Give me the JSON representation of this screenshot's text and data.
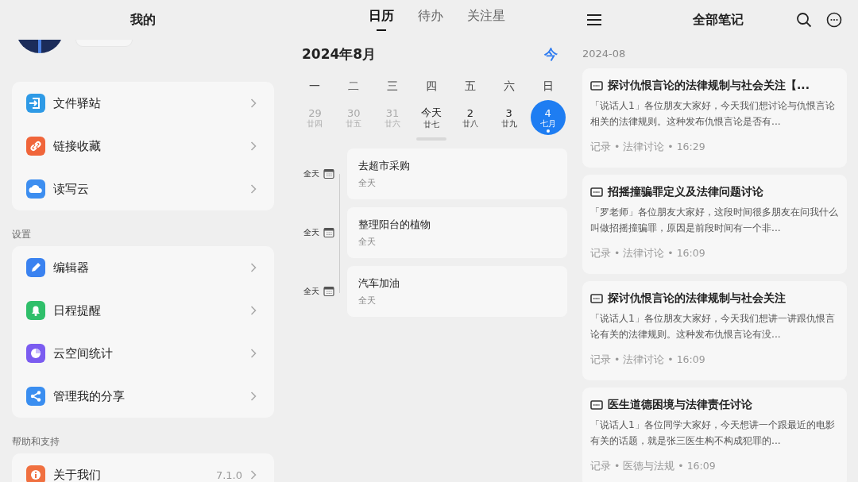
{
  "profile_screen": {
    "title": "我的",
    "groups": [
      {
        "items": [
          {
            "label": "文件驿站",
            "color": "#2e9ae6"
          },
          {
            "label": "链接收藏",
            "color": "#f0653a"
          },
          {
            "label": "读写云",
            "color": "#3d8ef0"
          }
        ]
      },
      {
        "heading": "设置",
        "items": [
          {
            "label": "编辑器",
            "color": "#3a82f0"
          },
          {
            "label": "日程提醒",
            "color": "#2fbf6a"
          },
          {
            "label": "云空间统计",
            "color": "#7b5cf0"
          },
          {
            "label": "管理我的分享",
            "color": "#3a8ef0"
          }
        ]
      },
      {
        "heading": "帮助和支持",
        "items": [
          {
            "label": "关于我们",
            "color": "#f07040",
            "value": "7.1.0"
          }
        ]
      }
    ]
  },
  "calendar_screen": {
    "tabs": [
      {
        "label": "日历",
        "selected": true
      },
      {
        "label": "待办",
        "selected": false
      },
      {
        "label": "关注星",
        "selected": false
      }
    ],
    "month": "2024年8月",
    "today_button": "今",
    "weekdays": [
      "一",
      "二",
      "三",
      "四",
      "五",
      "六",
      "日"
    ],
    "days": [
      {
        "day": "29",
        "lunar": "廿四",
        "other_month": true,
        "selected": false,
        "marked": false
      },
      {
        "day": "30",
        "lunar": "廿五",
        "other_month": true,
        "selected": false,
        "marked": false
      },
      {
        "day": "31",
        "lunar": "廿六",
        "other_month": true,
        "selected": false,
        "marked": false
      },
      {
        "day": "今天",
        "lunar": "廿七",
        "other_month": false,
        "selected": false,
        "marked": false
      },
      {
        "day": "2",
        "lunar": "廿八",
        "other_month": false,
        "selected": false,
        "marked": false
      },
      {
        "day": "3",
        "lunar": "廿九",
        "other_month": false,
        "selected": false,
        "marked": false
      },
      {
        "day": "4",
        "lunar": "七月",
        "other_month": false,
        "selected": true,
        "marked": true
      }
    ],
    "events": [
      {
        "time": "全天",
        "title": "去超市采购",
        "subtitle": "全天"
      },
      {
        "time": "全天",
        "title": "整理阳台的植物",
        "subtitle": "全天"
      },
      {
        "time": "全天",
        "title": "汽车加油",
        "subtitle": "全天"
      }
    ]
  },
  "notes_screen": {
    "title": "全部笔记",
    "section": "2024-08",
    "notes": [
      {
        "title": "探讨仇恨言论的法律规制与社会关注【...",
        "excerpt": "「说话人1」各位朋友大家好，今天我们想讨论与仇恨言论相关的法律规则。这种发布仇恨言论是否有...",
        "meta": "记录 • 法律讨论 • 16:29"
      },
      {
        "title": "招摇撞骗罪定义及法律问题讨论",
        "excerpt": "「罗老师」各位朋友大家好，这段时间很多朋友在问我什么叫做招摇撞骗罪，原因是前段时间有一个非...",
        "meta": "记录 • 法律讨论 • 16:09"
      },
      {
        "title": "探讨仇恨言论的法律规制与社会关注",
        "excerpt": "「说话人1」各位朋友大家好，今天我们想讲一讲跟仇恨言论有关的法律规则。这种发布仇恨言论有没...",
        "meta": "记录 • 法律讨论 • 16:09"
      },
      {
        "title": "医生道德困境与法律责任讨论",
        "excerpt": "「说话人1」各位同学大家好，今天想讲一个跟最近的电影有关的话题，就是张三医生构不构成犯罪的...",
        "meta": "记录 • 医德与法规 • 16:09"
      }
    ]
  }
}
